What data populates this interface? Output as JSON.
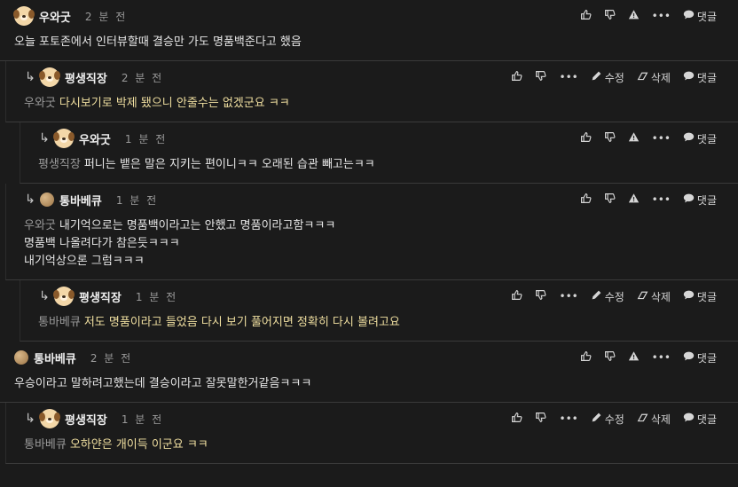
{
  "comments": [
    {
      "author": "우와굿",
      "time": "2 분 전",
      "avatar": "dog",
      "level": 0,
      "mention": "",
      "lines": [
        "오늘 포토존에서 인터뷰할때 결승만 가도 명품백준다고 했음"
      ],
      "highlight": false,
      "own": false
    },
    {
      "author": "평생직장",
      "time": "2 분 전",
      "avatar": "dog",
      "level": 1,
      "mention": "우와굿",
      "lines": [
        "다시보기로 박제 됐으니 안줄수는 없겠군요 ㅋㅋ"
      ],
      "highlight": true,
      "own": true
    },
    {
      "author": "우와굿",
      "time": "1 분 전",
      "avatar": "dog",
      "level": 2,
      "mention": "평생직장",
      "lines": [
        "퍼니는 뱉은 말은 지키는 편이니ㅋㅋ 오래된 습관 빼고는ㅋㅋ"
      ],
      "highlight": false,
      "own": false
    },
    {
      "author": "통바베큐",
      "time": "1 분 전",
      "avatar": "ball",
      "level": 1,
      "mention": "우와굿",
      "lines": [
        "내기억으로는 명품백이라고는 안했고 명품이라고함ㅋㅋㅋ",
        "명품백 나올려다가 참은듯ㅋㅋㅋ",
        "내기억상으론 그럼ㅋㅋㅋ"
      ],
      "highlight": false,
      "own": false
    },
    {
      "author": "평생직장",
      "time": "1 분 전",
      "avatar": "dog",
      "level": 2,
      "mention": "통바베큐",
      "lines": [
        "저도 명품이라고 들었음 다시 보기 풀어지면 정확히 다시 볼려고요"
      ],
      "highlight": true,
      "own": true
    },
    {
      "author": "통바베큐",
      "time": "2 분 전",
      "avatar": "ball",
      "level": 0,
      "mention": "",
      "lines": [
        "우승이라고 말하려고했는데 결승이라고 잘못말한거같음ㅋㅋㅋ"
      ],
      "highlight": false,
      "own": false
    },
    {
      "author": "평생직장",
      "time": "1 분 전",
      "avatar": "dog",
      "level": 1,
      "mention": "통바베큐",
      "lines": [
        "오하얀은 개이득 이군요 ㅋㅋ"
      ],
      "highlight": true,
      "own": true
    }
  ],
  "actions": {
    "like": "",
    "dislike": "",
    "report": "",
    "more": "•••",
    "edit": "수정",
    "delete": "삭제",
    "reply": "댓글"
  },
  "reply_arrow": "↳",
  "colors": {
    "background": "#1b1b1b",
    "highlight_text": "#f0dfa0",
    "muted": "#9a9a9a"
  }
}
